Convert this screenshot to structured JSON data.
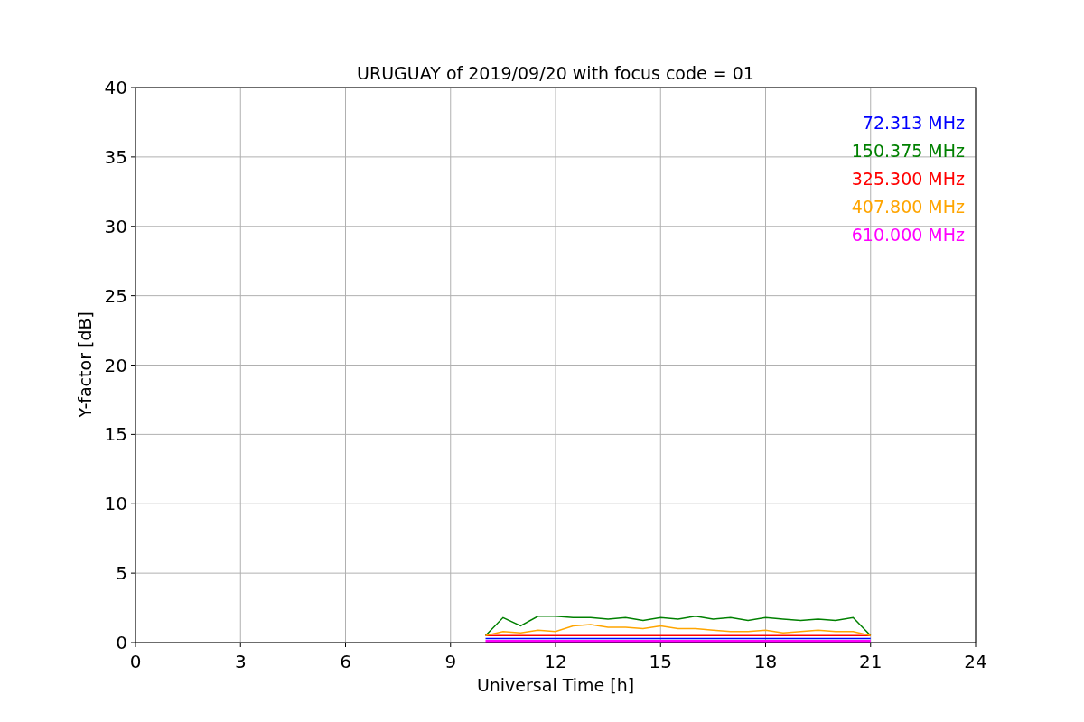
{
  "figure": {
    "chart_data": {
      "type": "line",
      "title": "URUGUAY of 2019/09/20 with focus code = 01",
      "xlabel": "Universal Time [h]",
      "ylabel": "Y-factor [dB]",
      "x": [
        10,
        10.5,
        11,
        11.5,
        12,
        12.5,
        13,
        13.5,
        14,
        14.5,
        15,
        15.5,
        16,
        16.5,
        17,
        17.5,
        18,
        18.5,
        19,
        19.5,
        20,
        20.5,
        21
      ],
      "series": [
        {
          "name": "72.313 MHz",
          "color": "#0000ff",
          "values": [
            0.3,
            0.3,
            0.3,
            0.3,
            0.3,
            0.3,
            0.3,
            0.3,
            0.3,
            0.3,
            0.3,
            0.3,
            0.3,
            0.3,
            0.3,
            0.3,
            0.3,
            0.3,
            0.3,
            0.3,
            0.3,
            0.3,
            0.3
          ]
        },
        {
          "name": "150.375 MHz",
          "color": "#008000",
          "values": [
            0.5,
            1.8,
            1.2,
            1.9,
            1.9,
            1.8,
            1.8,
            1.7,
            1.8,
            1.6,
            1.8,
            1.7,
            1.9,
            1.7,
            1.8,
            1.6,
            1.8,
            1.7,
            1.6,
            1.7,
            1.6,
            1.8,
            0.5
          ]
        },
        {
          "name": "325.300 MHz",
          "color": "#ff0000",
          "values": [
            0.5,
            0.5,
            0.5,
            0.5,
            0.5,
            0.5,
            0.5,
            0.5,
            0.5,
            0.5,
            0.5,
            0.5,
            0.5,
            0.5,
            0.5,
            0.5,
            0.5,
            0.5,
            0.5,
            0.5,
            0.5,
            0.5,
            0.5
          ]
        },
        {
          "name": "407.800 MHz",
          "color": "#ffa500",
          "values": [
            0.5,
            0.8,
            0.7,
            0.9,
            0.8,
            1.2,
            1.3,
            1.1,
            1.1,
            1.0,
            1.2,
            1.0,
            1.0,
            0.9,
            0.8,
            0.8,
            0.9,
            0.7,
            0.8,
            0.9,
            0.8,
            0.8,
            0.5
          ]
        },
        {
          "name": "610.000 MHz",
          "color": "#ff00ff",
          "values": [
            0.1,
            0.1,
            0.1,
            0.1,
            0.1,
            0.1,
            0.1,
            0.1,
            0.1,
            0.1,
            0.1,
            0.1,
            0.1,
            0.1,
            0.1,
            0.1,
            0.1,
            0.1,
            0.1,
            0.1,
            0.1,
            0.1,
            0.1
          ]
        }
      ],
      "grid": true,
      "xlim": [
        0,
        24
      ],
      "ylim": [
        0,
        40
      ],
      "xticks": [
        0,
        3,
        6,
        9,
        12,
        15,
        18,
        21,
        24
      ],
      "yticks": [
        0,
        5,
        10,
        15,
        20,
        25,
        30,
        35,
        40
      ]
    }
  }
}
